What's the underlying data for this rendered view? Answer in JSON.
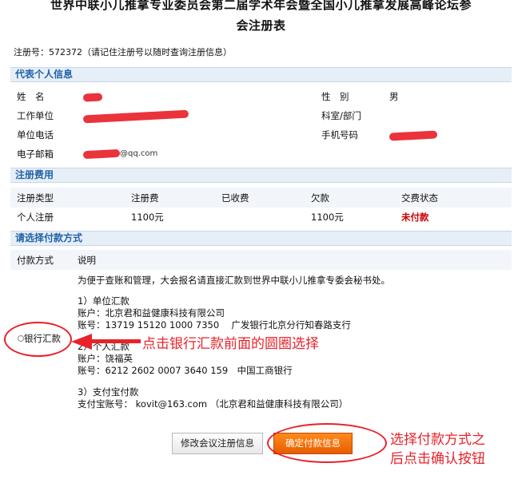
{
  "title": {
    "line1": "世界中联小儿推拿专业委员会第二届学术年会暨全国小儿推拿发展高峰论坛参",
    "line2": "会注册表"
  },
  "registration_number": "注册号：572372（请记住注册号以随时查询注册信息）",
  "personal": {
    "header": "代表个人信息",
    "name_label": "姓　名",
    "gender_label": "性　别",
    "gender_value": "男",
    "work_unit_label": "工作单位",
    "department_label": "科室/部门",
    "unit_phone_label": "单位电话",
    "mobile_label": "手机号码",
    "email_label": "电子邮箱",
    "email_visible": "@qq.com"
  },
  "fees": {
    "header": "注册费用",
    "columns": [
      "注册类型",
      "注册费",
      "已收费",
      "欠款",
      "交费状态"
    ],
    "row": {
      "type": "个人注册",
      "fee": "1100元",
      "paid": "",
      "owed": "1100元",
      "status": "未付款"
    }
  },
  "payment": {
    "header": "请选择付款方式",
    "col_method": "付款方式",
    "col_desc": "说明",
    "intro": "为便于查账和管理，大会报名请直接汇款到世界中联小儿推拿专委会秘书处。",
    "company_title": "1）单位汇款",
    "company_account_name": "账户：北京君和益健康科技有限公司",
    "company_account_no": "账号：13719 15120 1000 7350　 广发银行北京分行知春路支行",
    "personal_title": "2）个人汇款",
    "personal_account_name": "账户：饶福英",
    "personal_account_no": "账号：6212 2602 0007 3640 159　中国工商银行",
    "alipay_title": "3）支付宝付款",
    "alipay_account": "支付宝账号： kovit@163.com （北京君和益健康科技有限公司）",
    "option_label": "银行汇款",
    "option_selected": false
  },
  "buttons": {
    "modify": "修改会议注册信息",
    "confirm": "确定付款信息"
  },
  "annotations": {
    "arrow_text": "点击银行汇款前面的圆圈选择",
    "button_text_line1": "选择付款方式之",
    "button_text_line2": "后点击确认按钮",
    "color": "#e8222a"
  },
  "colors": {
    "section_header_text": "#2163a8",
    "section_header_bg": "#e6eef7",
    "unpaid": "#cc0000",
    "confirm_button": "#f07000"
  }
}
